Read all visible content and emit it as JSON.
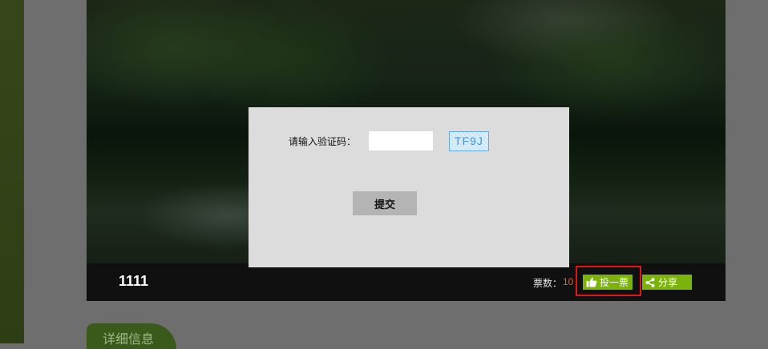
{
  "photo": {
    "title": "1111",
    "vote_label": "票数：",
    "vote_count": "10",
    "vote_button_label": "投一票",
    "share_button_label": "分享",
    "vote_icon": "thumbs-up-icon",
    "share_icon": "share-icon"
  },
  "section": {
    "detail_tab_label": "详细信息"
  },
  "dialog": {
    "captcha_label": "请输入验证码：",
    "captcha_value": "",
    "captcha_code": "TF9J",
    "submit_label": "提交"
  },
  "colors": {
    "accent_green": "#7bb30c",
    "vote_count": "#d9692a",
    "highlight": "#e01616",
    "dialog_bg": "#dcdcdc"
  }
}
